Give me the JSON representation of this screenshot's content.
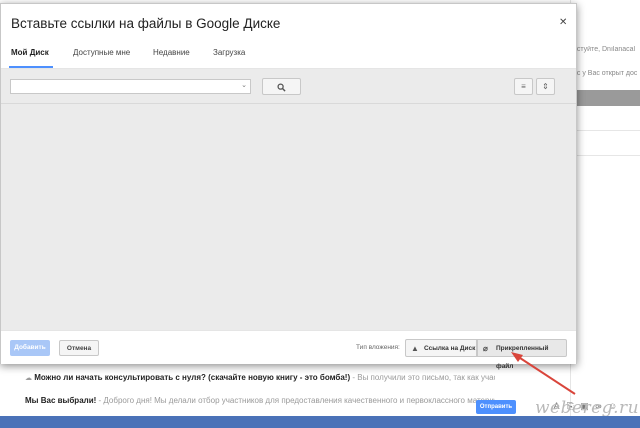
{
  "background": {
    "right_snippets": [
      "астуйте, Dnılanacal",
      "ас у Вас открыт дос"
    ],
    "email_rows": [
      {
        "subject": "Можно ли начать консультировать с нуля? (скачайте новую книгу - это бомба!)",
        "snippet": " - Вы получили это письмо, так как участвовали",
        "bold_prefix": ""
      },
      {
        "subject": "Мы Вас выбрали!",
        "snippet": " - Доброго дня! Мы делали отбор участников для предоставления качественного и первоклассного материала. Мы р",
        "bold_prefix": ""
      }
    ],
    "compose": {
      "send_label": "Отправить"
    },
    "watermark": "webereg.ru"
  },
  "dialog": {
    "title": "Вставьте ссылки на файлы в Google Диске",
    "close_icon": "close-icon",
    "tabs": [
      {
        "label": "Мой Диск",
        "active": true
      },
      {
        "label": "Доступные мне",
        "active": false
      },
      {
        "label": "Недавние",
        "active": false
      },
      {
        "label": "Загрузка",
        "active": false
      }
    ],
    "search": {
      "value": "",
      "placeholder": ""
    },
    "footer": {
      "add_label": "Добавить",
      "cancel_label": "Отмена",
      "insert_type_label": "Тип вложения:",
      "drive_link_label": "Ссылка на Диск",
      "attachment_label": "Прикрепленный файл"
    }
  },
  "colors": {
    "accent": "#4d90fe",
    "arrow": "#d9453b",
    "bottom_bar": "#4a72b8"
  }
}
